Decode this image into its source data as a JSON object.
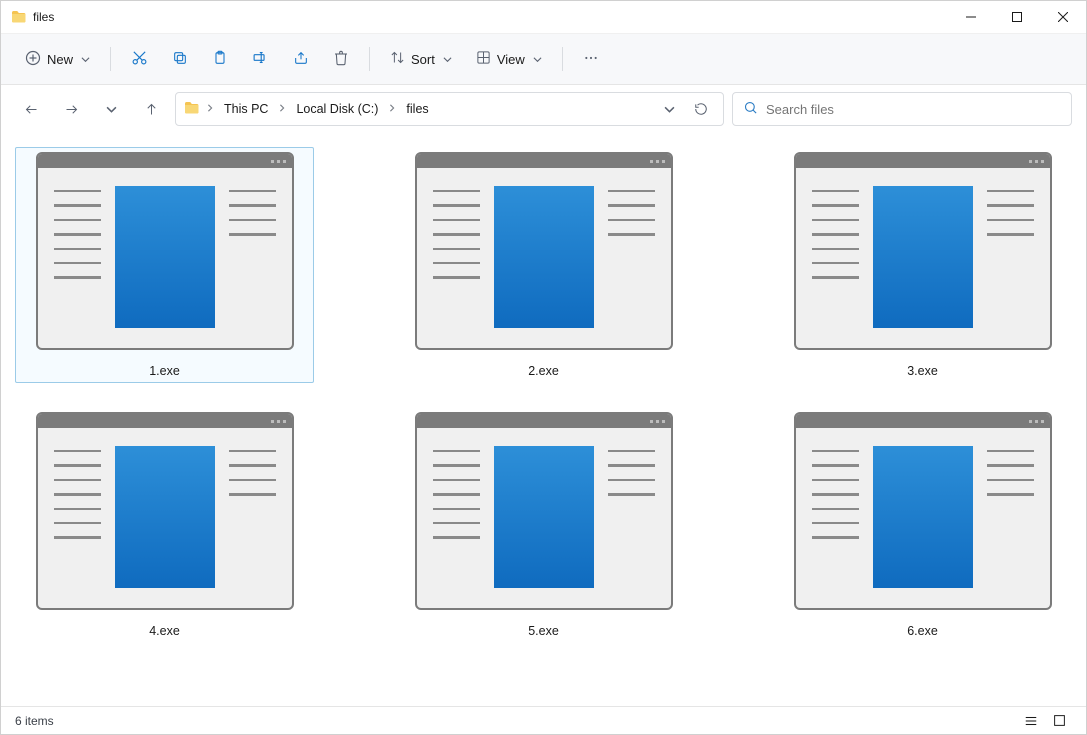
{
  "window": {
    "title": "files"
  },
  "toolbar": {
    "new_label": "New",
    "sort_label": "Sort",
    "view_label": "View"
  },
  "breadcrumb": {
    "segments": [
      "This PC",
      "Local Disk (C:)",
      "files"
    ]
  },
  "search": {
    "placeholder": "Search files"
  },
  "files": {
    "items": [
      {
        "name": "1.exe",
        "selected": true
      },
      {
        "name": "2.exe",
        "selected": false
      },
      {
        "name": "3.exe",
        "selected": false
      },
      {
        "name": "4.exe",
        "selected": false
      },
      {
        "name": "5.exe",
        "selected": false
      },
      {
        "name": "6.exe",
        "selected": false
      }
    ]
  },
  "status": {
    "count_text": "6 items"
  }
}
